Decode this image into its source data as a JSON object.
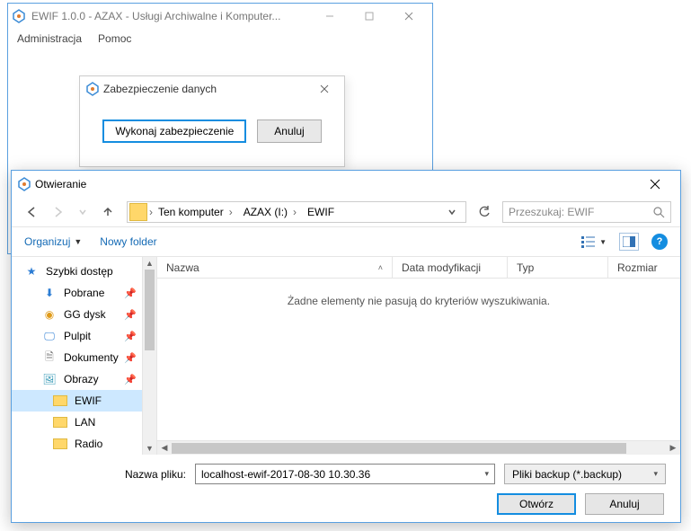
{
  "app": {
    "title": "EWIF 1.0.0 - AZAX - Usługi Archiwalne i Komputer...",
    "menu": {
      "admin": "Administracja",
      "help": "Pomoc"
    }
  },
  "backupDialog": {
    "title": "Zabezpieczenie danych",
    "do_backup": "Wykonaj zabezpieczenie",
    "cancel": "Anuluj"
  },
  "openDialog": {
    "title": "Otwieranie",
    "breadcrumb": {
      "seg0": "Ten komputer",
      "seg1": "AZAX (I:)",
      "seg2": "EWIF"
    },
    "search_placeholder": "Przeszukaj: EWIF",
    "toolbar": {
      "organize": "Organizuj",
      "new_folder": "Nowy folder"
    },
    "columns": {
      "name": "Nazwa",
      "modified": "Data modyfikacji",
      "type": "Typ",
      "size": "Rozmiar"
    },
    "empty_message": "Żadne elementy nie pasują do kryteriów wyszukiwania.",
    "sidebar": {
      "quick": "Szybki dostęp",
      "items": [
        {
          "label": "Pobrane"
        },
        {
          "label": "GG dysk"
        },
        {
          "label": "Pulpit"
        },
        {
          "label": "Dokumenty"
        },
        {
          "label": "Obrazy"
        },
        {
          "label": "EWIF"
        },
        {
          "label": "LAN"
        },
        {
          "label": "Radio"
        }
      ]
    },
    "filename_label": "Nazwa pliku:",
    "filename_value": "localhost-ewif-2017-08-30 10.30.36",
    "filetype_value": "Pliki backup (*.backup)",
    "open_btn": "Otwórz",
    "cancel_btn": "Anuluj"
  }
}
